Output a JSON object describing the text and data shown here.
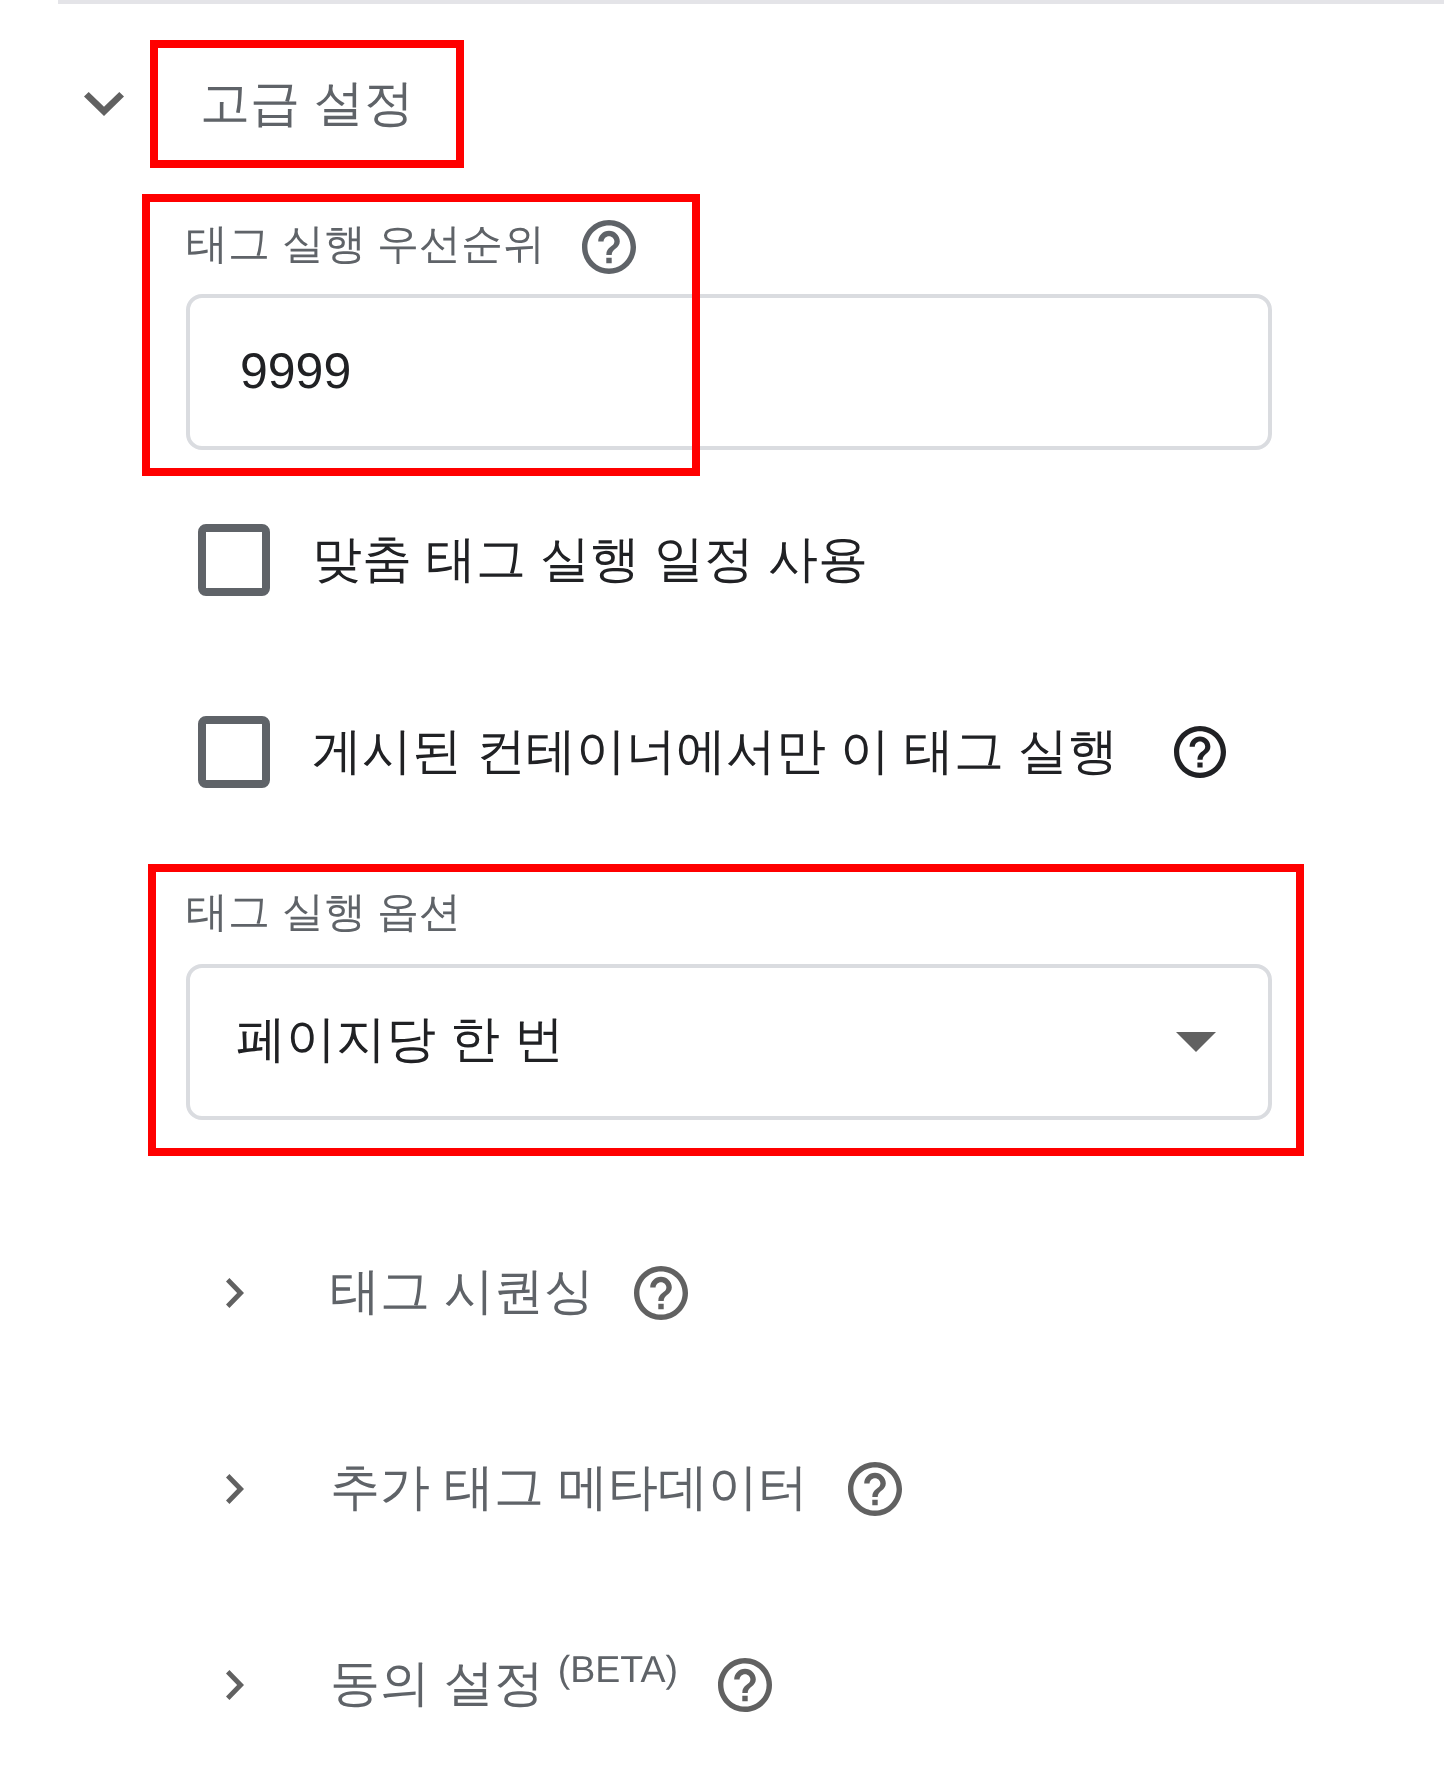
{
  "section": {
    "title": "고급 설정",
    "expanded": true,
    "highlighted": true
  },
  "priority_field": {
    "label": "태그 실행 우선순위",
    "help": true,
    "value": "9999",
    "highlighted": true
  },
  "checkboxes": [
    {
      "label": "맞춤 태그 실행 일정 사용",
      "checked": false,
      "help": false
    },
    {
      "label": "게시된 컨테이너에서만 이 태그 실행",
      "checked": false,
      "help": true
    }
  ],
  "firing_option": {
    "label": "태그 실행 옵션",
    "value": "페이지당 한 번",
    "highlighted": true
  },
  "subsections": [
    {
      "title": "태그 시퀀싱",
      "expanded": false,
      "help": true
    },
    {
      "title": "추가 태그 메타데이터",
      "expanded": false,
      "help": true
    },
    {
      "title": "동의 설정 $^{(BETA)}$",
      "expanded": false,
      "help": true
    }
  ]
}
